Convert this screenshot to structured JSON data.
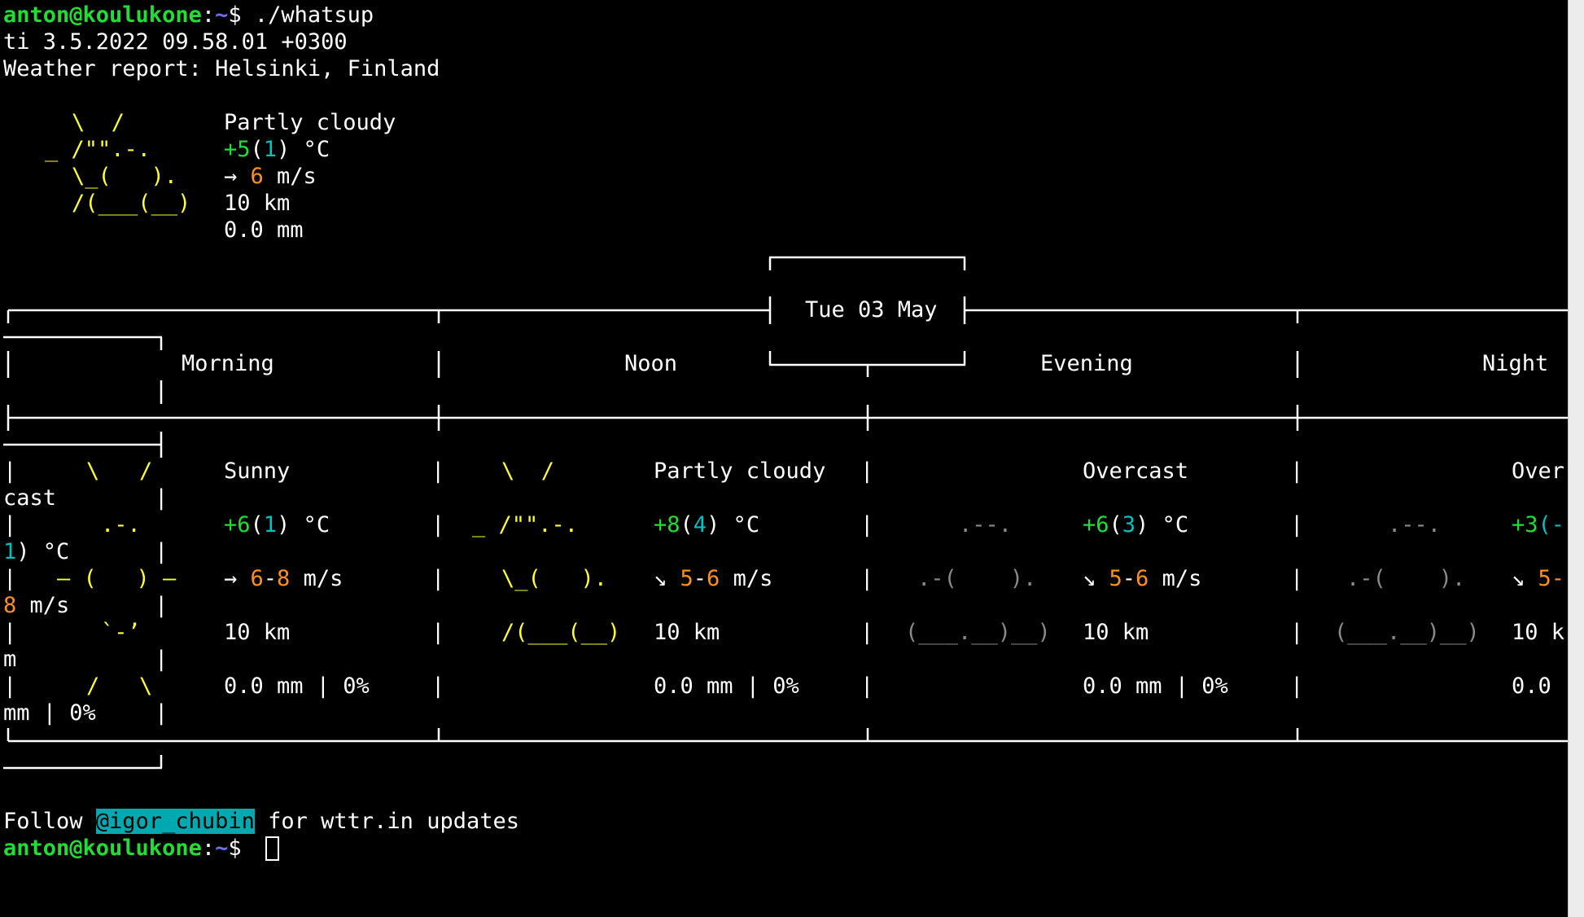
{
  "prompt": {
    "user_host": "anton@koulukone",
    "sep": ":",
    "path": "~",
    "symbol": "$ "
  },
  "command": "./whatsup",
  "datetime": "ti 3.5.2022 09.58.01 +0300",
  "report_title": "Weather report: Helsinki, Finland",
  "current": {
    "art": [
      "\\  /",
      "_ /\"\".-.",
      "\\_(   ).",
      "/(___(__)"
    ],
    "condition": "Partly cloudy",
    "temp_main": "+5",
    "temp_feels": "1",
    "temp_unit": ") °C",
    "wind_arrow": "→ ",
    "wind_speed": "6",
    "wind_unit": " m/s",
    "visibility": "10 km",
    "precip": "0.0 mm"
  },
  "day_label": "Tue 03 May",
  "periods": {
    "morning": {
      "label": "Morning",
      "art": [
        "\\   /",
        ".-.",
        "― (   ) ―",
        "`-’",
        "/   \\"
      ],
      "condition": "Sunny",
      "temp_main": "+6",
      "temp_feels": "1",
      "temp_unit": ") °C",
      "wind_arrow": "→ ",
      "wind_low": "6",
      "wind_high": "8",
      "wind_unit": " m/s",
      "visibility": "10 km",
      "precip": "0.0 mm | 0%",
      "wrap": [
        "cast",
        "1",
        ") °C",
        "8",
        " m/s",
        "m",
        "mm | 0%"
      ]
    },
    "noon": {
      "label": "Noon",
      "art": [
        "\\  /",
        "_ /\"\".-.",
        "\\_(   ).",
        "/(___(__)"
      ],
      "condition": "Partly cloudy",
      "temp_main": "+8",
      "temp_feels": "4",
      "temp_unit": ") °C",
      "wind_arrow": "↘ ",
      "wind_low": "5",
      "wind_high": "6",
      "wind_unit": " m/s",
      "visibility": "10 km",
      "precip": "0.0 mm | 0%"
    },
    "evening": {
      "label": "Evening",
      "art": [
        ".--.",
        ".-(    ).",
        "(___.__)__)"
      ],
      "condition": "Overcast",
      "temp_main": "+6",
      "temp_feels": "3",
      "temp_unit": ") °C",
      "wind_arrow": "↘ ",
      "wind_low": "5",
      "wind_high": "6",
      "wind_unit": " m/s",
      "visibility": "10 km",
      "precip": "0.0 mm | 0%"
    },
    "night": {
      "label": "Night",
      "art": [
        ".--.",
        ".-(    ).",
        "(___.__)__)"
      ],
      "condition": "Over",
      "temp_main": "+3",
      "temp_rest": "(-",
      "wind_arrow": "↘ ",
      "wind_low": "5-",
      "visibility": "10 k",
      "precip": "0.0"
    }
  },
  "dash": "-",
  "feels_open": "(",
  "footer": {
    "before": "Follow ",
    "handle": "@igor_chubin",
    "after": " for wttr.in updates"
  }
}
